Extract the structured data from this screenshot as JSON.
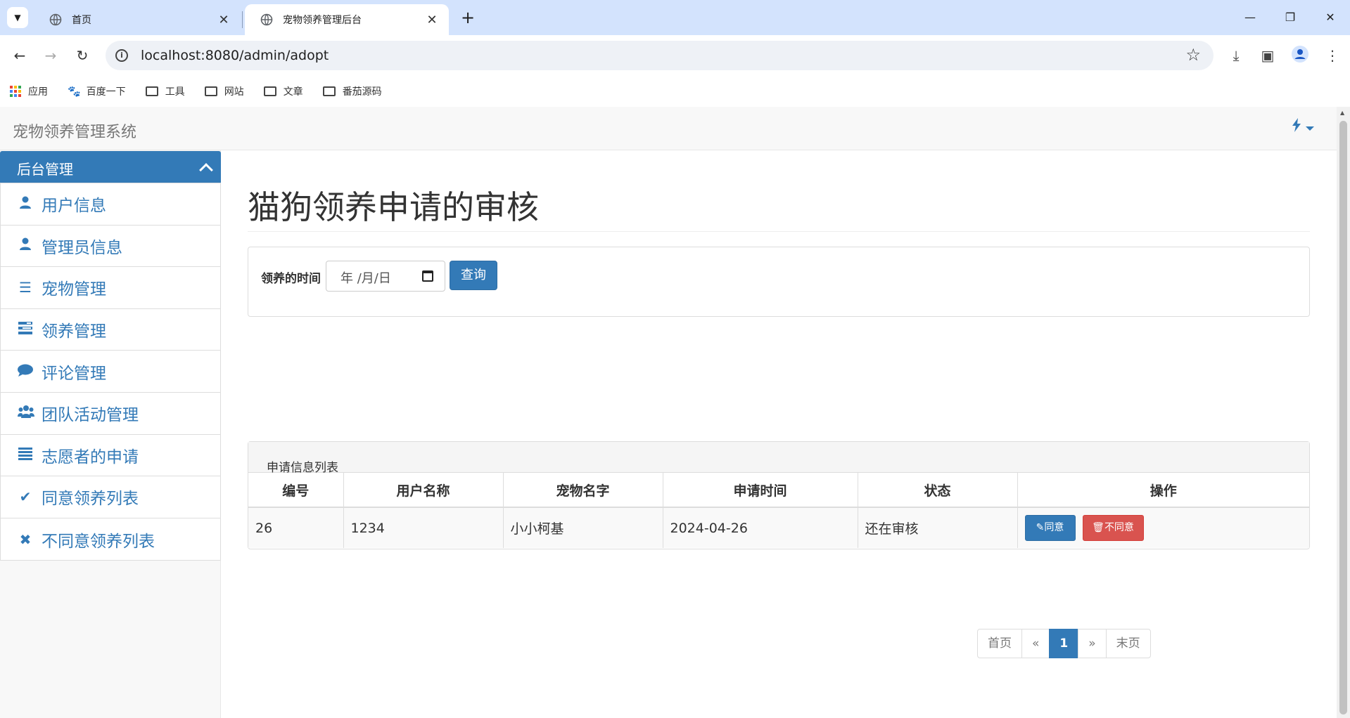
{
  "browser": {
    "tabs": [
      {
        "title": "首页",
        "active": false
      },
      {
        "title": "宠物领养管理后台",
        "active": true
      }
    ],
    "url": "localhost:8080/admin/adopt",
    "bookmarks": [
      "应用",
      "百度一下",
      "工具",
      "网站",
      "文章",
      "番茄源码"
    ]
  },
  "navbar": {
    "brand": "宠物领养管理系统"
  },
  "sidebar": {
    "header": "后台管理",
    "items": [
      {
        "label": "用户信息",
        "icon": "user-icon"
      },
      {
        "label": "管理员信息",
        "icon": "user-icon"
      },
      {
        "label": "宠物管理",
        "icon": "list-icon"
      },
      {
        "label": "领养管理",
        "icon": "tasks-icon"
      },
      {
        "label": "评论管理",
        "icon": "comment-icon"
      },
      {
        "label": "团队活动管理",
        "icon": "group-icon"
      },
      {
        "label": "志愿者的申请",
        "icon": "list-icon"
      },
      {
        "label": "同意领养列表",
        "icon": "check-icon"
      },
      {
        "label": "不同意领养列表",
        "icon": "x-icon"
      }
    ]
  },
  "main": {
    "title": "猫狗领养申请的审核",
    "search": {
      "label": "领养的时间",
      "date_placeholder": "年 /月/日",
      "button": "查询"
    },
    "list": {
      "heading": "申请信息列表",
      "columns": [
        "编号",
        "用户名称",
        "宠物名字",
        "申请时间",
        "状态",
        "操作"
      ],
      "rows": [
        {
          "id": "26",
          "user": "1234",
          "pet": "小小柯基",
          "time": "2024-04-26",
          "status": "还在审核",
          "agree": "同意",
          "reject": "不同意"
        }
      ]
    },
    "pagination": [
      "首页",
      "«",
      "1",
      "»",
      "末页"
    ]
  },
  "colors": {
    "primary": "#337ab7",
    "danger": "#d9534f",
    "tabstrip": "#d3e3fd"
  }
}
